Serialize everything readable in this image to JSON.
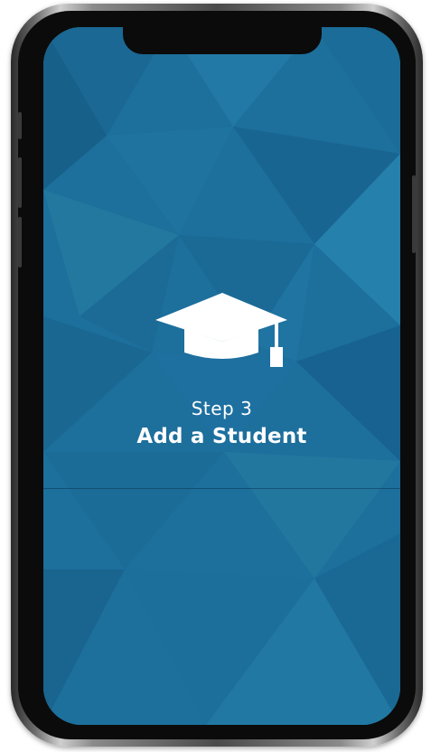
{
  "onboarding": {
    "step_label": "Step 3",
    "step_title": "Add a Student",
    "icon": "graduation-cap-icon"
  },
  "colors": {
    "screen_background": "#1d6f9c",
    "text": "#ffffff"
  }
}
